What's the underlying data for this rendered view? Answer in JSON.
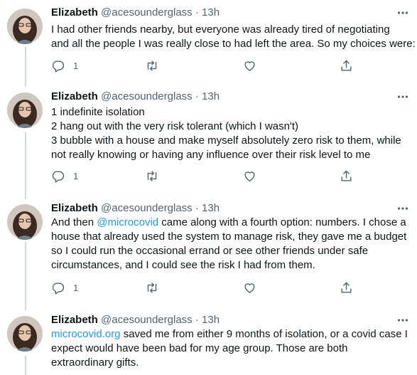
{
  "tweets": [
    {
      "author": "Elizabeth",
      "handle": "@acesounderglass",
      "separator": "·",
      "time": "13h",
      "lines": [
        "I had other friends nearby, but everyone was already tired of negotiating",
        "and all the people I was really close to had left the area. So my choices were:"
      ],
      "reply_count": "1"
    },
    {
      "author": "Elizabeth",
      "handle": "@acesounderglass",
      "separator": "·",
      "time": "13h",
      "lines": [
        "1 indefinite isolation",
        "2 hang out with the very risk tolerant (which I wasn't)",
        "3 bubble with a house and make myself absolutely zero risk to them, while",
        "not really knowing or having any influence over their risk level to me"
      ],
      "reply_count": "1"
    },
    {
      "author": "Elizabeth",
      "handle": "@acesounderglass",
      "separator": "·",
      "time": "13h",
      "line1_pre": "And then ",
      "line1_link": "@microcovid",
      "line1_post": " came along with a fourth option: numbers. I chose a",
      "lines_rest": [
        "house that already used the system to manage risk, they gave me a budget",
        "so I could run the occasional errand or see other friends under safe",
        "circumstances, and I could see the risk I had from them."
      ],
      "reply_count": "1"
    },
    {
      "author": "Elizabeth",
      "handle": "@acesounderglass",
      "separator": "·",
      "time": "13h",
      "line1_link": "microcovid.org",
      "line1_post": " saved me from either 9 months of isolation, or a covid case I",
      "lines_rest": [
        "expect would have been bad for my age group. Those are both",
        "extraordinary gifts."
      ]
    }
  ],
  "icons": {
    "reply": "reply-icon",
    "retweet": "retweet-icon",
    "like": "heart-icon",
    "share": "share-icon",
    "more": "more-icon"
  },
  "colors": {
    "text": "#0f1419",
    "secondary": "#536471",
    "link": "#1d9bf0",
    "thread_line": "#cfd9de"
  }
}
